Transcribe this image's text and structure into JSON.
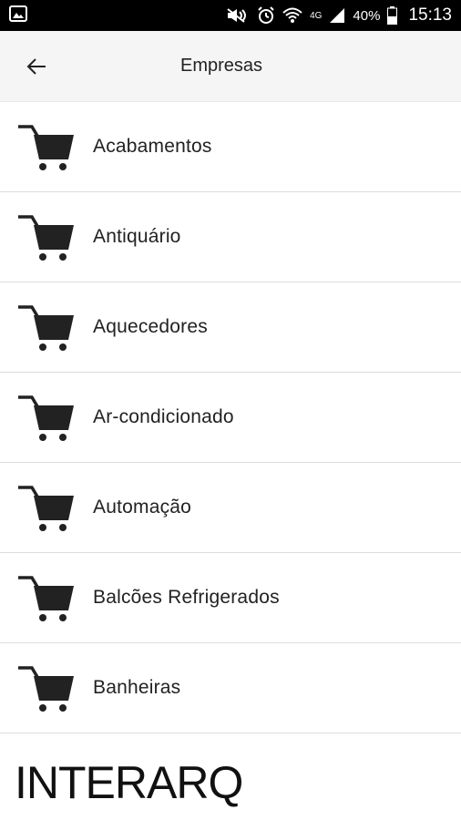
{
  "status_bar": {
    "battery": "40%",
    "time": "15:13",
    "network": "4G"
  },
  "header": {
    "title": "Empresas",
    "back_icon": "arrow-left-icon"
  },
  "categories": [
    {
      "label": "Acabamentos",
      "icon": "shopping-cart-icon"
    },
    {
      "label": "Antiquário",
      "icon": "shopping-cart-icon"
    },
    {
      "label": "Aquecedores",
      "icon": "shopping-cart-icon"
    },
    {
      "label": "Ar-condicionado",
      "icon": "shopping-cart-icon"
    },
    {
      "label": "Automação",
      "icon": "shopping-cart-icon"
    },
    {
      "label": "Balcões Refrigerados",
      "icon": "shopping-cart-icon"
    },
    {
      "label": "Banheiras",
      "icon": "shopping-cart-icon"
    }
  ],
  "footer": {
    "logo_text": "INTERARQ"
  }
}
